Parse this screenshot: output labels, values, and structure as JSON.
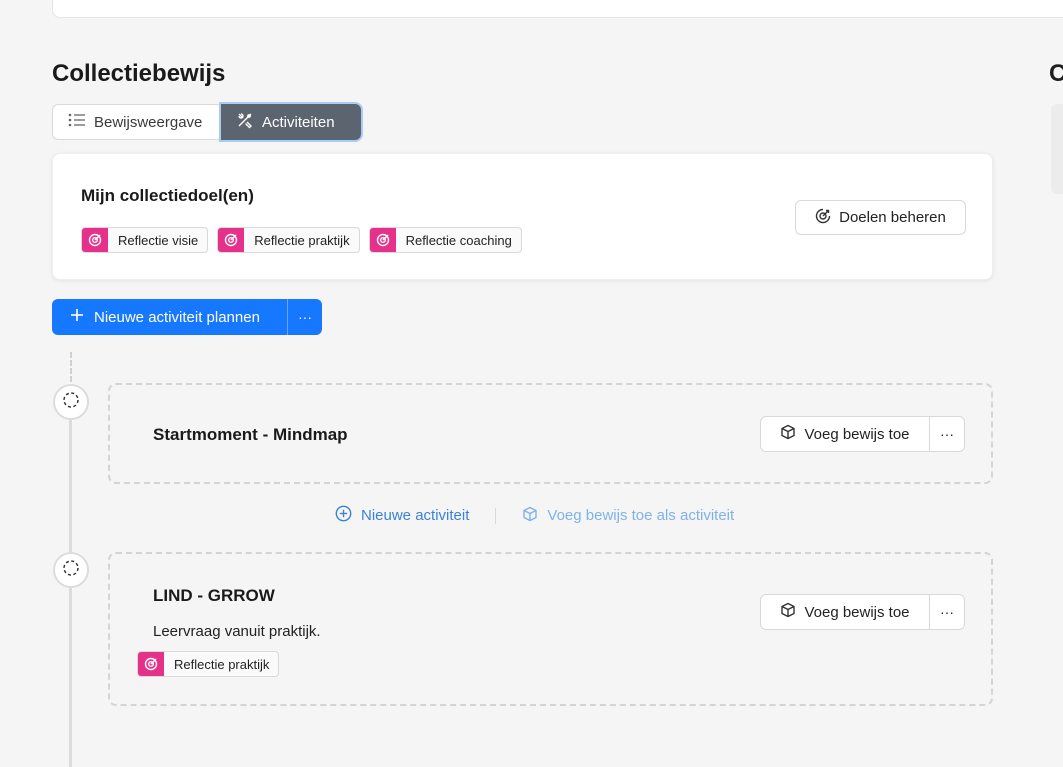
{
  "page": {
    "title": "Collectiebewijs",
    "right_title": "C"
  },
  "view_switch": {
    "list_label": "Bewijsweergave",
    "activities_label": "Activiteiten"
  },
  "goals": {
    "title": "Mijn collectiedoel(en)",
    "tags": [
      "Reflectie visie",
      "Reflectie praktijk",
      "Reflectie coaching"
    ],
    "manage_label": "Doelen beheren"
  },
  "primary": {
    "label": "Nieuwe activiteit plannen",
    "more": "···"
  },
  "activities": [
    {
      "title": "Startmoment - Mindmap",
      "add_label": "Voeg bewijs toe",
      "more": "···"
    },
    {
      "title": "LIND - GRROW",
      "description": "Leervraag vanuit praktijk.",
      "tag": "Reflectie praktijk",
      "add_label": "Voeg bewijs toe",
      "more": "···"
    }
  ],
  "between": {
    "new_activity": "Nieuwe activiteit",
    "add_as_activity": "Voeg bewijs toe als activiteit"
  },
  "colors": {
    "accent": "#1677ff",
    "tag": "#e6318a",
    "segment_active": "#5c6470",
    "link": "#3b82d6"
  },
  "icons": {
    "list": "list-icon",
    "activities": "tools-icon",
    "goal": "target-icon",
    "plus": "plus-icon",
    "box": "box-icon",
    "node": "dashed-circle-icon",
    "add_circle": "plus-circle-icon"
  }
}
